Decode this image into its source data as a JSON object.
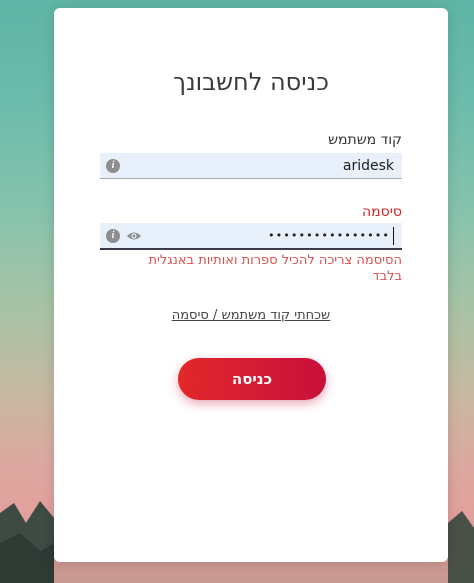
{
  "login": {
    "title": "כניסה לחשבונך",
    "username": {
      "label": "קוד משתמש",
      "value": "aridesk",
      "info_icon": "i"
    },
    "password": {
      "label": "סיסמה",
      "value": "••••••••••••••••",
      "info_icon": "i",
      "error": "הסיסמה צריכה להכיל ספרות ואותיות באנגלית בלבד"
    },
    "forgot_link": "שכחתי קוד משתמש / סיסמה",
    "submit_label": "כניסה"
  },
  "colors": {
    "accent": "#d2232a",
    "button_gradient_start": "#e2282a",
    "button_gradient_end": "#c8103b",
    "field_bg": "#e8f0fc"
  },
  "icons": [
    "info-icon",
    "eye-icon"
  ]
}
